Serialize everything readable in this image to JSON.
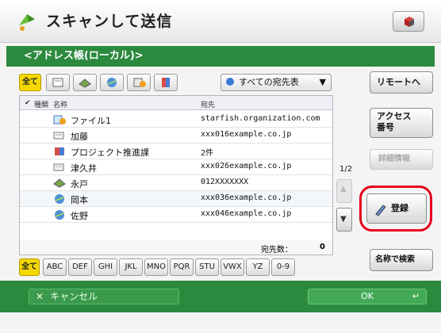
{
  "title": "スキャンして送信",
  "address_book": "<アドレス帳(ローカル)>",
  "filter": {
    "all": "全て",
    "dropdown": "すべての宛先表"
  },
  "list": {
    "headers": {
      "type": "種類",
      "name": "名称",
      "dest": "宛先"
    },
    "rows": [
      {
        "name": "ファイル1",
        "dest": "starfish.organization.com"
      },
      {
        "name": "加藤",
        "dest": "xxx016example.co.jp"
      },
      {
        "name": "プロジェクト推進課",
        "dest": "2件"
      },
      {
        "name": "津久井",
        "dest": "xxx026example.co.jp"
      },
      {
        "name": "永戸",
        "dest": "012XXXXXXX"
      },
      {
        "name": "岡本",
        "dest": "xxx036example.co.jp"
      },
      {
        "name": "佐野",
        "dest": "xxx046example.co.jp"
      }
    ],
    "count_label": "宛先数：",
    "count_value": "0"
  },
  "letters": [
    "全て",
    "ABC",
    "DEF",
    "GHI",
    "JKL",
    "MNO",
    "PQR",
    "STU",
    "VWX",
    "YZ",
    "0-9"
  ],
  "pager": "1/2",
  "right": {
    "remote": "リモートへ",
    "access": "アクセス\n番号",
    "details": "詳細情報",
    "register": "登録",
    "name_search": "名称で検索"
  },
  "bottom": {
    "cancel": "キャンセル",
    "ok": "OK"
  }
}
